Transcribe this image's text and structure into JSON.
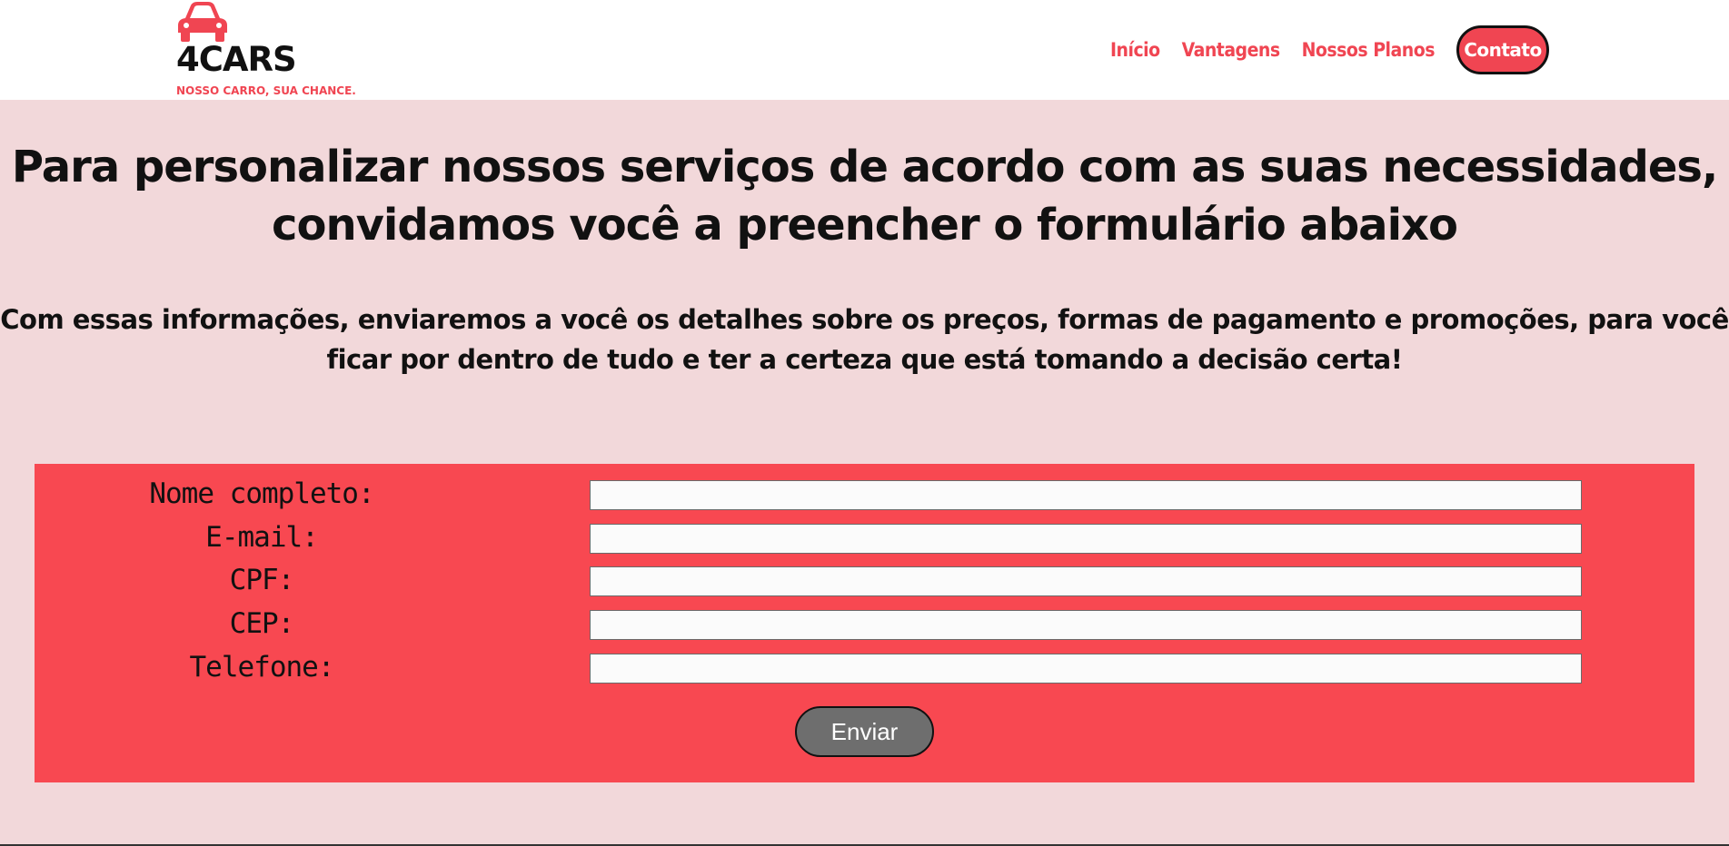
{
  "brand": {
    "name": "4CARS",
    "tagline": "NOSSO CARRO, SUA CHANCE.",
    "logo_icon": "car-icon",
    "accent_color": "#f04552"
  },
  "nav": {
    "items": [
      {
        "label": "Início"
      },
      {
        "label": "Vantagens"
      },
      {
        "label": "Nossos Planos"
      }
    ],
    "contact_label": "Contato"
  },
  "main": {
    "headline": "Para personalizar nossos serviços de acordo com as suas necessidades, convidamos você a preencher o formulário abaixo",
    "subtext": "Com essas informações, enviaremos a você os detalhes sobre os preços, formas de pagamento e promoções, para você ficar por dentro de tudo e ter a certeza que está tomando a decisão certa!"
  },
  "form": {
    "fields": [
      {
        "label": "Nome completo:",
        "value": ""
      },
      {
        "label": "E-mail:",
        "value": ""
      },
      {
        "label": "CPF:",
        "value": ""
      },
      {
        "label": "CEP:",
        "value": ""
      },
      {
        "label": "Telefone:",
        "value": ""
      }
    ],
    "submit_label": "Enviar",
    "panel_color": "#f84851"
  }
}
